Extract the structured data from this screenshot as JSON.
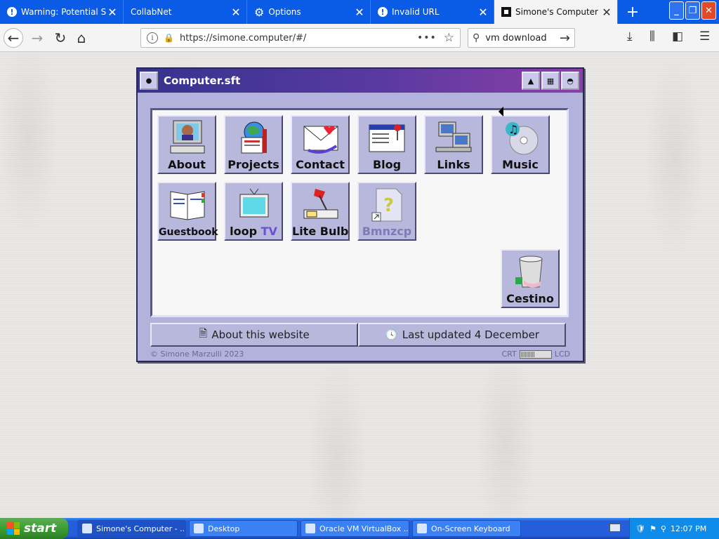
{
  "browser": {
    "tabs": [
      {
        "label": "Warning: Potential Secu",
        "favicon": "warning-icon",
        "active": false
      },
      {
        "label": "CollabNet",
        "favicon": "none",
        "active": false
      },
      {
        "label": "Options",
        "favicon": "gear-icon",
        "active": false
      },
      {
        "label": "Invalid URL",
        "favicon": "warning-icon",
        "active": false
      },
      {
        "label": "Simone's Computer",
        "favicon": "simone-icon",
        "active": true
      }
    ],
    "new_tab_label": "+",
    "url": "https://simone.computer/#/",
    "search_text": "vm download"
  },
  "window": {
    "title": "Computer.sft",
    "icons": [
      {
        "label": "About",
        "icon": "computer-user-icon"
      },
      {
        "label": "Projects",
        "icon": "globe-tools-icon"
      },
      {
        "label": "Contact",
        "icon": "letter-icon"
      },
      {
        "label": "Blog",
        "icon": "newspaper-icon"
      },
      {
        "label": "Links",
        "icon": "network-icon"
      },
      {
        "label": "Music",
        "icon": "cd-music-icon"
      },
      {
        "label": "Guestbook",
        "icon": "book-icon"
      },
      {
        "label_main": "loop ",
        "label_accent": "TV",
        "icon": "tv-icon"
      },
      {
        "label": "Lite Bulb",
        "icon": "lamp-icon"
      },
      {
        "label": "Bmnzcp",
        "icon": "unknown-file-icon"
      },
      {
        "label": "Cestino",
        "icon": "trash-icon"
      }
    ],
    "about_button": "About this website",
    "updated_button": "Last updated 4 December",
    "copyright": "© Simone Marzulli 2023",
    "crt_label": "CRT",
    "lcd_label": "LCD"
  },
  "taskbar": {
    "start_label": "start",
    "items": [
      {
        "label": "Simone's Computer - ...",
        "active": true
      },
      {
        "label": "Desktop",
        "active": false
      },
      {
        "label": "Oracle VM VirtualBox ...",
        "active": false
      },
      {
        "label": "On-Screen Keyboard",
        "active": false
      }
    ],
    "clock": "12:07 PM"
  },
  "colors": {
    "xp_blue": "#0a5ce6",
    "title_gradient_start": "#35338e",
    "title_gradient_end": "#8b3fa8",
    "icon_tile": "#b8b7dc",
    "start_green": "#3c9e32"
  }
}
